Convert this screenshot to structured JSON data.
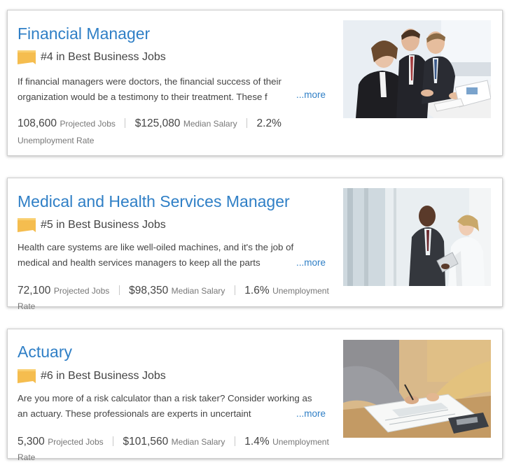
{
  "jobs": [
    {
      "title": "Financial Manager",
      "rank": "#4 in Best Business Jobs",
      "desc_line1": "If financial managers were doctors, the financial success of their",
      "desc_line2": "organization would be a testimony to their treatment. These f",
      "more": "...more",
      "projected_jobs": "108,600",
      "projected_label": "Projected Jobs",
      "salary": "$125,080",
      "salary_label": "Median Salary",
      "unemployment": "2.2%",
      "unemployment_label": "Unemployment Rate"
    },
    {
      "title": "Medical and Health Services Manager",
      "rank": "#5 in Best Business Jobs",
      "desc_line1": "Health care systems are like well-oiled machines, and it's the job of",
      "desc_line2": "medical and health services managers to keep all the parts",
      "more": "...more",
      "projected_jobs": "72,100",
      "projected_label": "Projected Jobs",
      "salary": "$98,350",
      "salary_label": "Median Salary",
      "unemployment": "1.6%",
      "unemployment_label": "Unemployment Rate"
    },
    {
      "title": "Actuary",
      "rank": "#6 in Best Business Jobs",
      "desc_line1": "Are you more of a risk calculator than a risk taker? Consider working as",
      "desc_line2": "an actuary. These professionals are experts in uncertaint",
      "more": "...more",
      "projected_jobs": "5,300",
      "projected_label": "Projected Jobs",
      "salary": "$101,560",
      "salary_label": "Median Salary",
      "unemployment": "1.4%",
      "unemployment_label": "Unemployment Rate"
    }
  ],
  "colors": {
    "title_link": "#2f7fc6",
    "badge": "#f5bd4f",
    "text": "#444444",
    "label": "#777777"
  },
  "icons": {
    "rank_badge": "ribbon-badge-icon"
  }
}
